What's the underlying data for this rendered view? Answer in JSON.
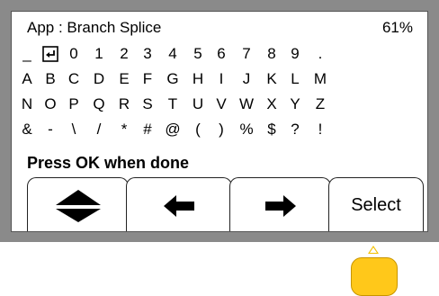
{
  "header": {
    "app_title": "App : Branch Splice",
    "battery": "61%"
  },
  "keyboard": {
    "rows": [
      [
        "_",
        "backspace-icon",
        "0",
        "1",
        "2",
        "3",
        "4",
        "5",
        "6",
        "7",
        "8",
        "9",
        "."
      ],
      [
        "A",
        "B",
        "C",
        "D",
        "E",
        "F",
        "G",
        "H",
        "I",
        "J",
        "K",
        "L",
        "M"
      ],
      [
        "N",
        "O",
        "P",
        "Q",
        "R",
        "S",
        "T",
        "U",
        "V",
        "W",
        "X",
        "Y",
        "Z"
      ],
      [
        "&",
        "-",
        "\\",
        "/",
        "*",
        "#",
        "@",
        "(",
        ")",
        "%",
        "$",
        "?",
        "!"
      ]
    ]
  },
  "prompt": "Press OK when done",
  "softkeys": {
    "toggle_icon": "up-down-diamond-icon",
    "left_icon": "left-arrow-icon",
    "right_icon": "right-arrow-icon",
    "select_label": "Select"
  },
  "hardware": {
    "ok_button_icon": "ok-button",
    "indicator_icon": "up-triangle-icon",
    "ok_color": "#ffc81a"
  }
}
